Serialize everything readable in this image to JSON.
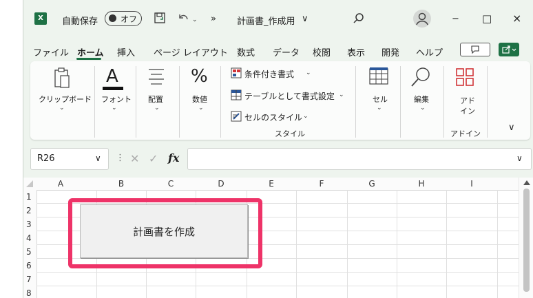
{
  "titlebar": {
    "autosave_label": "自動保存",
    "autosave_state": "オフ",
    "more": "»",
    "filename": "計画書_作成用",
    "filename_chevron": "∨",
    "search_icon": "search-icon",
    "minimize": "−",
    "maximize": "□",
    "close": "×"
  },
  "menu": {
    "tabs": [
      "ファイル",
      "ホーム",
      "挿入",
      "ページ レイアウト",
      "数式",
      "データ",
      "校閲",
      "表示",
      "開発",
      "ヘルプ"
    ],
    "active_tab": "ホーム"
  },
  "ribbon": {
    "clipboard": "クリップボード",
    "font": "フォント",
    "alignment": "配置",
    "number": "数値",
    "number_symbol": "%",
    "font_symbol": "A",
    "conditional_format": "条件付き書式",
    "format_as_table": "テーブルとして書式設定",
    "cell_styles": "セルのスタイル",
    "styles_group": "スタイル",
    "cells": "セル",
    "editing": "編集",
    "addin_line1": "アド",
    "addin_line2": "イン",
    "addin_group": "アドイン",
    "chev": "⌄",
    "dropdown": "⌄"
  },
  "formula_bar": {
    "name_box": "R26",
    "name_box_chevron": "∨",
    "colon": "⋮",
    "cancel": "✕",
    "enter": "✓",
    "fx": "fx",
    "expand": "∨"
  },
  "grid": {
    "columns": [
      "A",
      "B",
      "C",
      "D",
      "E",
      "F",
      "G",
      "H",
      "I"
    ],
    "rows": [
      "1",
      "2",
      "3",
      "4",
      "5",
      "6",
      "7",
      "8"
    ]
  },
  "macro_button": {
    "label": "計画書を作成"
  },
  "colors": {
    "accent": "#1e7145",
    "highlight": "#ee3368"
  }
}
